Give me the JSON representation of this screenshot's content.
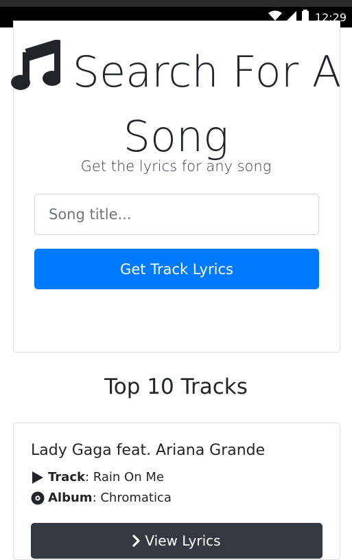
{
  "status_bar": {
    "time": "12:29",
    "icons": [
      "wifi-icon",
      "signal-icon",
      "battery-icon"
    ]
  },
  "search_card": {
    "title": "Search For A Song",
    "title_icon": "music-note-icon",
    "subtitle": "Get the lyrics for any song",
    "input_placeholder": "Song title...",
    "input_value": "",
    "submit_label": "Get Track Lyrics"
  },
  "top_tracks": {
    "heading": "Top 10 Tracks",
    "items": [
      {
        "artist": "Lady Gaga feat. Ariana Grande",
        "track_label": "Track",
        "track": "Rain On Me",
        "album_label": "Album",
        "album": "Chromatica",
        "button_label": "View Lyrics"
      }
    ]
  },
  "colors": {
    "primary": "#007bff",
    "dark": "#343a40",
    "text": "#212529",
    "border": "#dcdcdc"
  }
}
